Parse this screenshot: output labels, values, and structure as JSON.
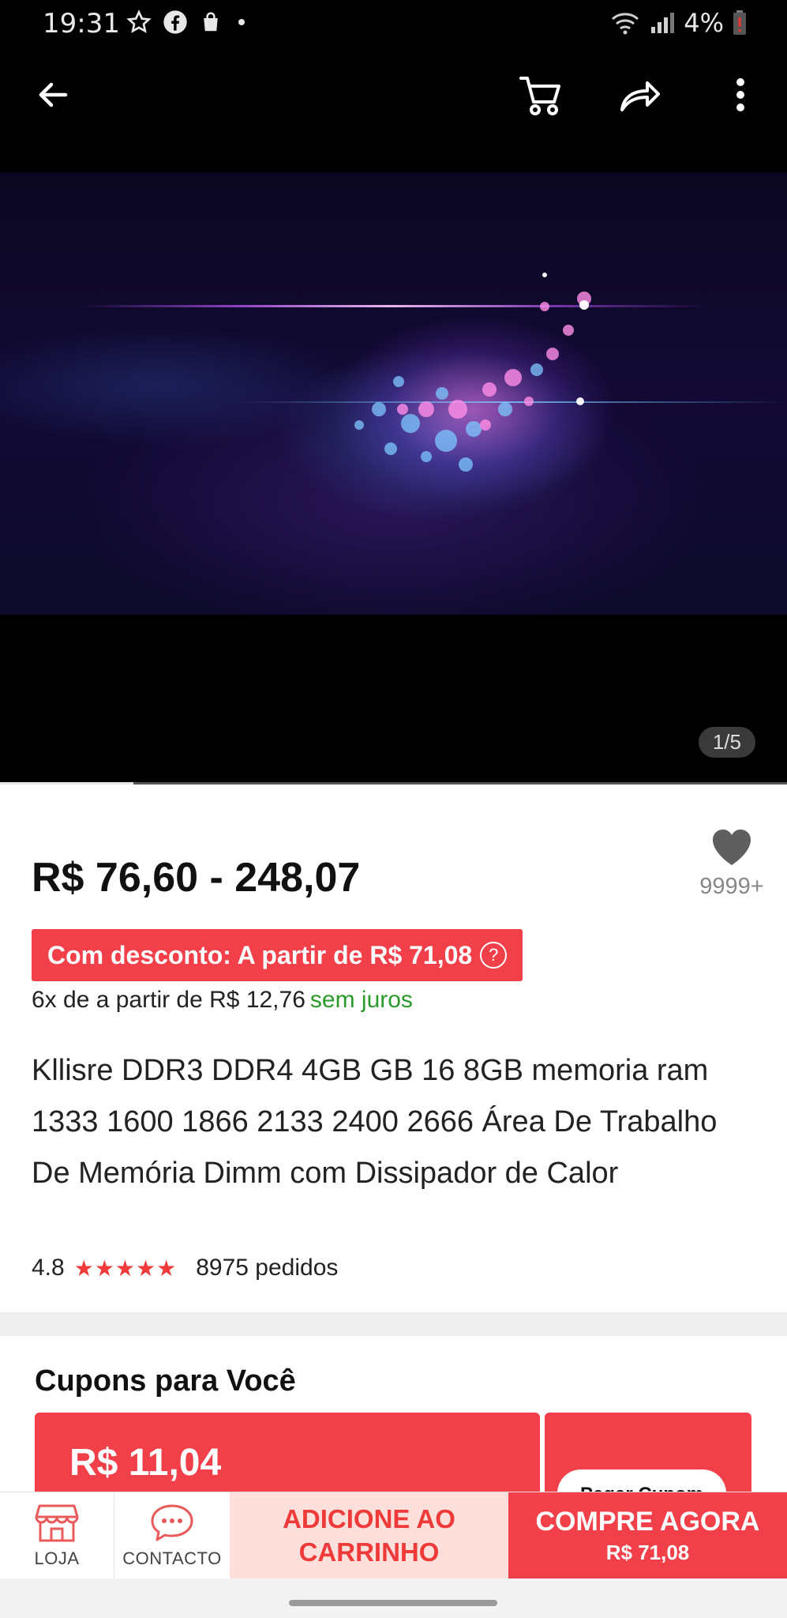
{
  "status_bar": {
    "time": "19:31",
    "battery": "4%",
    "icons_left": [
      "star-icon",
      "facebook-icon",
      "shopping-bag-icon",
      "dot-icon"
    ],
    "icons_right": [
      "wifi-icon",
      "signal-icon",
      "battery-icon"
    ]
  },
  "app_bar": {
    "icons": [
      "back-arrow-icon",
      "cart-icon",
      "share-icon",
      "more-vertical-icon"
    ]
  },
  "media": {
    "counter": "1/5",
    "progress": 0.17
  },
  "product": {
    "price_range": "R$ 76,60 - 248,07",
    "wishlist_count": "9999+",
    "discount_text": "Com desconto: A partir de R$ 71,08",
    "installments_text": "6x de a partir de R$ 12,76",
    "installments_note": "sem juros",
    "title": "Kllisre DDR3 DDR4 4GB GB 16 8GB memoria ram 1333 1600 1866 2133 2400 2666 Área De Trabalho De Memória Dimm com Dissipador de Calor",
    "rating": "4.8",
    "stars": "★★★★★",
    "orders": "8975 pedidos"
  },
  "coupons": {
    "title": "Cupons para Você",
    "value": "R$ 11,04",
    "button": "Pegar Cupom"
  },
  "bottom_bar": {
    "store_label": "LOJA",
    "contact_label": "CONTACTO",
    "add_to_cart_line1": "ADICIONE AO",
    "add_to_cart_line2": "CARRINHO",
    "buy_now_label": "COMPRE AGORA",
    "buy_now_price": "R$ 71,08"
  },
  "colors": {
    "accent_red": "#f2404a",
    "soft_red": "#fde0dc",
    "green": "#2a9a2a"
  }
}
